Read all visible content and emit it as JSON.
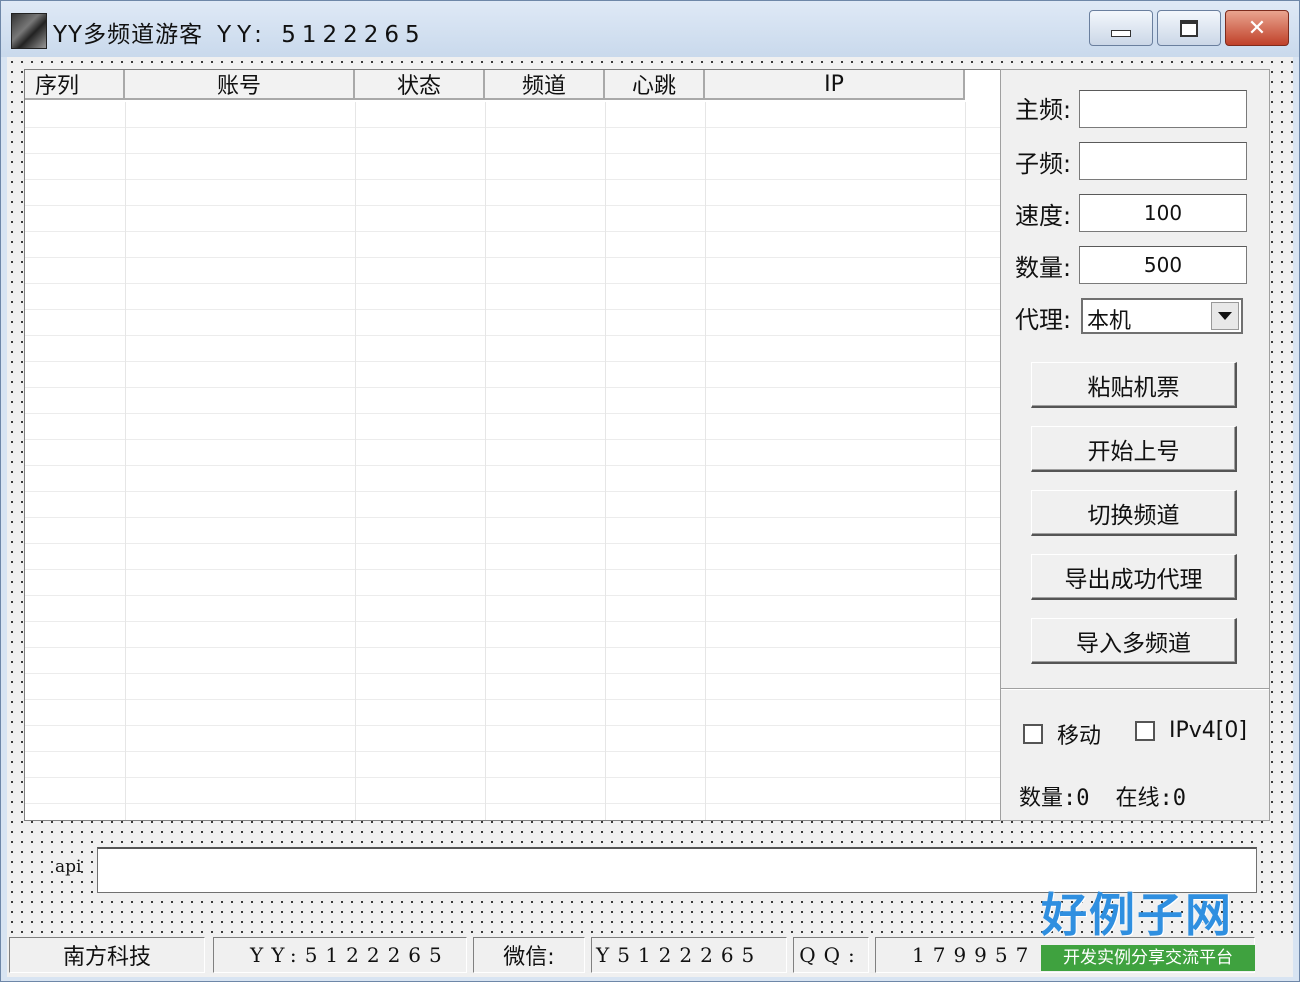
{
  "window": {
    "title": "YY多频道游客",
    "title_yy": "YY: 5122265",
    "close_glyph": "✕"
  },
  "list": {
    "columns": [
      "序列",
      "账号",
      "状态",
      "频道",
      "心跳",
      "IP"
    ]
  },
  "panel": {
    "main_label": "主频:",
    "main_value": "",
    "sub_label": "子频:",
    "sub_value": "",
    "speed_label": "速度:",
    "speed_value": "100",
    "count_label": "数量:",
    "count_value": "500",
    "proxy_label": "代理:",
    "proxy_value": "本机",
    "buttons": [
      "粘贴机票",
      "开始上号",
      "切换频道",
      "导出成功代理",
      "导入多频道"
    ],
    "chk_move": "移动",
    "chk_ipv4": "IPv4[0]",
    "stat_count": "数量:0",
    "stat_online": "在线:0"
  },
  "api": {
    "label": "api",
    "value": ""
  },
  "status": {
    "company": "南方科技",
    "yy_label": "YY:",
    "yy_value": "5122265",
    "wechat_label": "微信:",
    "wechat_value": "Y5122265",
    "qq_label": "QQ:",
    "qq_value": "179957"
  },
  "watermark": {
    "logo": "好例子网",
    "tagline": "开发实例分享交流平台"
  },
  "colors": {
    "title_bar": "#c9d9ec",
    "close_button": "#c0412a",
    "watermark_blue": "#2f8fe0",
    "watermark_green": "#3fa23f"
  }
}
